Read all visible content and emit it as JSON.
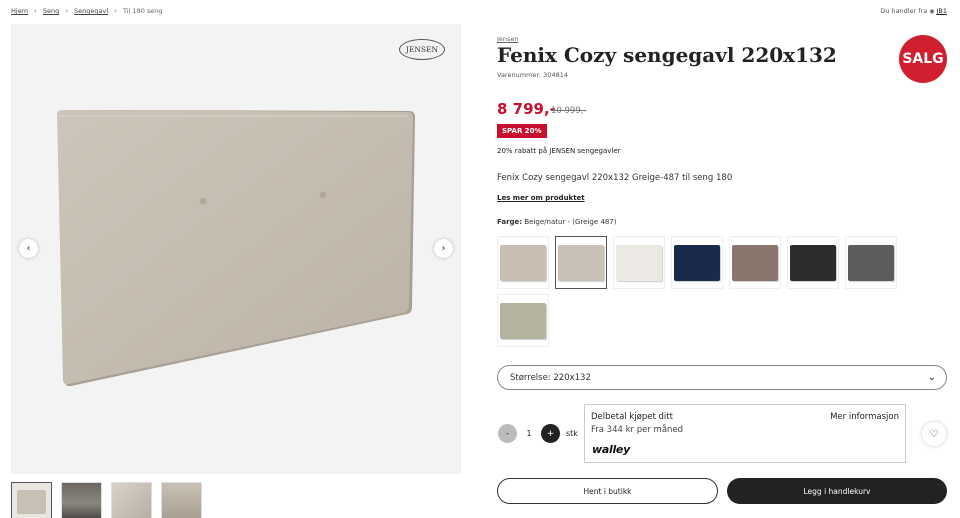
{
  "breadcrumb": {
    "items": [
      "Hjem",
      "Seng",
      "Sengegavl",
      "Til 180 seng"
    ]
  },
  "store": {
    "prefix": "Du handler fra",
    "name": "JB1"
  },
  "gallery": {
    "brand_badge": "JENSEN",
    "thumbnail_count": 4
  },
  "product": {
    "brand": "Jensen",
    "title": "Fenix Cozy sengegavl 220x132",
    "sku": "Varenummer: 304814",
    "sale_badge": "SALG",
    "price": "8 799,-",
    "old_price": "10 999,-",
    "save_badge": "SPAR 20%",
    "promo": "20% rabatt på JENSEN sengegavler",
    "description": "Fenix Cozy sengegavl 220x132 Greige-487 til seng 180",
    "read_more": "Les mer om produktet",
    "color_label": "Farge:",
    "color_value": "Beige/natur - (Greige 487)"
  },
  "swatches": [
    {
      "color": "#c8bfb2",
      "selected": false
    },
    {
      "color": "#c9c1b5",
      "selected": true
    },
    {
      "color": "#ece9e4",
      "selected": false
    },
    {
      "color": "#1a2a4a",
      "selected": false
    },
    {
      "color": "#8a766c",
      "selected": false
    },
    {
      "color": "#2d2d2d",
      "selected": false
    },
    {
      "color": "#5b5c5e",
      "selected": false
    },
    {
      "color": "#b4b3a0",
      "selected": false
    }
  ],
  "size": {
    "label": "Størrelse: 220x132"
  },
  "quantity": {
    "minus": "-",
    "value": "1",
    "plus": "+",
    "unit": "stk"
  },
  "finance": {
    "title": "Delbetal kjøpet ditt",
    "subtitle": "Fra 344 kr per måned",
    "more": "Mer informasjon",
    "provider": "walley"
  },
  "buttons": {
    "store": "Hent i butikk",
    "cart": "Legg i handlekurv"
  },
  "colors": {
    "accent_red": "#c8102e",
    "sale_red": "#d0202f",
    "dark": "#222222"
  },
  "icons": {
    "arrow_prev": "chevron-left-icon",
    "arrow_next": "chevron-right-icon",
    "heart": "heart-icon",
    "pin": "location-pin-icon",
    "dropdown": "chevron-down-icon"
  }
}
